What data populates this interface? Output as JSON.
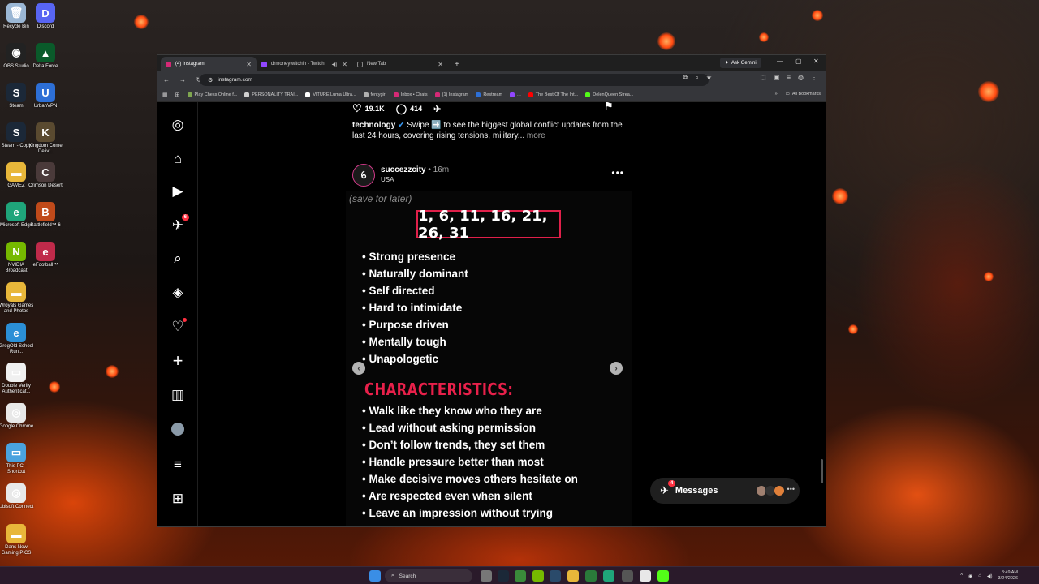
{
  "desktop": {
    "icons": [
      {
        "label": "Recycle Bin",
        "color": "#9bb7d4",
        "glyph": "🗑"
      },
      {
        "label": "Discord",
        "color": "#5865f2",
        "glyph": "D"
      },
      {
        "label": "OBS Studio",
        "color": "#222222",
        "glyph": "◉"
      },
      {
        "label": "Delta Force",
        "color": "#0a5a2a",
        "glyph": "▲"
      },
      {
        "label": "Steam",
        "color": "#1b2838",
        "glyph": "S"
      },
      {
        "label": "UrbanVPN",
        "color": "#2d6fd6",
        "glyph": "U"
      },
      {
        "label": "Steam - Copy",
        "color": "#1b2838",
        "glyph": "S"
      },
      {
        "label": "Kingdom Come Deliv...",
        "color": "#5a4a30",
        "glyph": "K"
      },
      {
        "label": "GAMEZ",
        "color": "#e8b73a",
        "glyph": "▬"
      },
      {
        "label": "Crimson Desert",
        "color": "#4a3a3a",
        "glyph": "C"
      },
      {
        "label": "Microsoft Edge",
        "color": "#1fa57a",
        "glyph": "e"
      },
      {
        "label": "Battlefield™ 6",
        "color": "#c04a1a",
        "glyph": "B"
      },
      {
        "label": "NVIDIA Broadcast",
        "color": "#76b900",
        "glyph": "N"
      },
      {
        "label": "eFootball™",
        "color": "#c02a4a",
        "glyph": "e"
      },
      {
        "label": "Wroyals Games and Photos",
        "color": "#e8b73a",
        "glyph": "▬"
      },
      {
        "label": "GregOld School Run...",
        "color": "#2b8fd6",
        "glyph": "e"
      },
      {
        "label": "Double Verify Authenticat...",
        "color": "#f0f0f0",
        "glyph": "▭"
      },
      {
        "label": "Google Chrome",
        "color": "#e8e8e8",
        "glyph": "◎"
      },
      {
        "label": "This PC - Shortcut",
        "color": "#4aa3df",
        "glyph": "▭"
      },
      {
        "label": "Ubisoft Connect",
        "color": "#e8e8e8",
        "glyph": "◎"
      },
      {
        "label": "Dans New Gaming PICS",
        "color": "#e8b73a",
        "glyph": "▬"
      }
    ]
  },
  "browser": {
    "tabs": [
      {
        "title": "(4) Instagram",
        "active": true,
        "favicon_color": "#d62976"
      },
      {
        "title": "drmoneytwitchin - Twitch",
        "active": false,
        "favicon_color": "#9146ff"
      },
      {
        "title": "New Tab",
        "active": false,
        "favicon_color": ""
      }
    ],
    "new_tab_label": "+",
    "ask_gemini": "Ask Gemini",
    "url": "instagram.com",
    "bookmarks": [
      {
        "label": "Play Chess Online f...",
        "color": "#7fa650"
      },
      {
        "label": "PERSONALITY TRAI...",
        "color": "#d0d0d0"
      },
      {
        "label": "VITURE Luma Ultra...",
        "color": "#ffffff"
      },
      {
        "label": "fentygirl",
        "color": "#b0b0b0"
      },
      {
        "label": "Inbox • Chats",
        "color": "#d62976"
      },
      {
        "label": "(1) Instagram",
        "color": "#d62976"
      },
      {
        "label": "Restream",
        "color": "#2d6fd6"
      },
      {
        "label": "...",
        "color": "#9146ff"
      },
      {
        "label": "The Best Of The Int...",
        "color": "#ff0000"
      },
      {
        "label": "DelenQueen Strea...",
        "color": "#53fc18"
      }
    ],
    "all_bookmarks": "All Bookmarks"
  },
  "instagram": {
    "sidebar": [
      {
        "name": "instagram-logo-icon",
        "glyph": "◎"
      },
      {
        "name": "home-icon",
        "glyph": "⌂"
      },
      {
        "name": "reels-icon",
        "glyph": "▶"
      },
      {
        "name": "direct-messages-icon",
        "glyph": "✈",
        "badge": "6"
      },
      {
        "name": "search-icon",
        "glyph": "⌕"
      },
      {
        "name": "explore-icon",
        "glyph": "◈"
      },
      {
        "name": "notifications-icon",
        "glyph": "♡",
        "dot": true
      },
      {
        "name": "create-icon",
        "glyph": "+"
      },
      {
        "name": "dashboard-icon",
        "glyph": "▥"
      },
      {
        "name": "profile-avatar-icon",
        "glyph": "●"
      },
      {
        "name": "menu-icon",
        "glyph": "≡"
      },
      {
        "name": "also-from-meta-icon",
        "glyph": "⊞"
      }
    ],
    "prev_post": {
      "likes": "19.1K",
      "comments": "414",
      "caption_user": "technology",
      "caption_text": "Swipe ➡️ to see the biggest global conflict updates from the last 24 hours, covering rising tensions, military...",
      "more": "more"
    },
    "post": {
      "username": "succezzcity",
      "time": "• 16m",
      "location": "USA",
      "avatar_glyph": "ꕃ",
      "save_later": "(save for later)",
      "numbers": "1, 6, 11, 16, 21, 26, 31",
      "traits": [
        "Strong presence",
        "Naturally dominant",
        "Self directed",
        "Hard to intimidate",
        "Purpose driven",
        "Mentally tough",
        "Unapologetic"
      ],
      "characteristics_title": "CHARACTERISTICS:",
      "characteristics": [
        "Walk like they know who they are",
        "Lead without asking permission",
        "Don’t follow trends, they set them",
        "Handle pressure better than most",
        "Make decisive moves others hesitate on",
        "Are respected even when silent",
        "Leave an impression without trying"
      ]
    },
    "messages": {
      "label": "Messages",
      "badge": "4"
    }
  },
  "taskbar": {
    "search": "Search",
    "time": "8:49 AM",
    "date": "3/24/2026"
  }
}
